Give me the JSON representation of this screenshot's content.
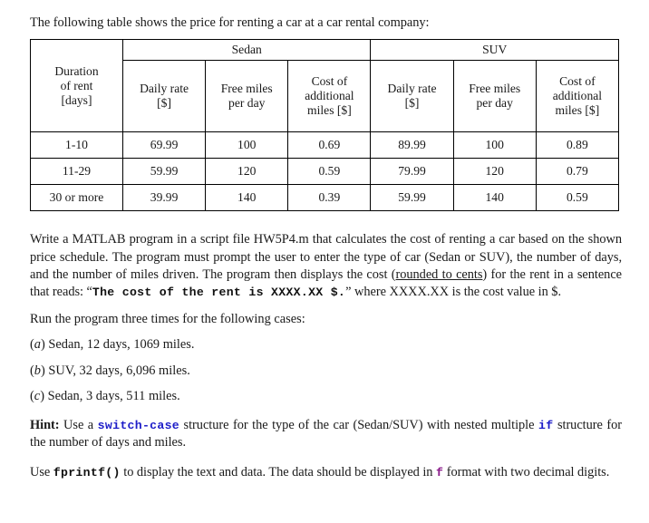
{
  "intro": {
    "text": "The following table shows the price for renting a car at a car rental company:"
  },
  "table": {
    "duration_header": {
      "line1": "Duration",
      "line2": "of rent",
      "line3": "[days]"
    },
    "groups": [
      {
        "name": "Sedan"
      },
      {
        "name": "SUV"
      }
    ],
    "sub_headers": [
      {
        "line1": "Daily rate",
        "line2": "[$]"
      },
      {
        "line1": "Free miles",
        "line2": "per day"
      },
      {
        "line1": "Cost of",
        "line2": "additional",
        "line3": "miles [$]"
      }
    ],
    "rows": [
      {
        "duration": "1-10",
        "sedan_daily": "69.99",
        "sedan_free": "100",
        "sedan_cost": "0.69",
        "suv_daily": "89.99",
        "suv_free": "100",
        "suv_cost": "0.89"
      },
      {
        "duration": "11-29",
        "sedan_daily": "59.99",
        "sedan_free": "120",
        "sedan_cost": "0.59",
        "suv_daily": "79.99",
        "suv_free": "120",
        "suv_cost": "0.79"
      },
      {
        "duration": "30 or more",
        "sedan_daily": "39.99",
        "sedan_free": "140",
        "sedan_cost": "0.39",
        "suv_daily": "59.99",
        "suv_free": "140",
        "suv_cost": "0.59"
      }
    ]
  },
  "problem": {
    "part1": "Write a MATLAB program in a script file HW5P4.m that calculates the cost of renting a car based on the shown price schedule. The program must prompt the user to enter the type of car (Sedan or SUV), the number of days, and the number of miles driven. The program then displays the cost (",
    "underlined": "rounded to cents",
    "part2": ") for the rent in a sentence that reads: “",
    "code_sentence_1": "The cost of the rent is XXXX.XX $.",
    "part3": "”  where XXXX.XX is the cost value in $."
  },
  "run_section": {
    "lead": "Run the program three times for the following cases:",
    "cases": [
      {
        "letter": "a",
        "open": "(",
        "close": ")",
        "text": " Sedan, 12 days, 1069 miles."
      },
      {
        "letter": "b",
        "open": "(",
        "close": ")",
        "text": " SUV, 32 days, 6,096 miles."
      },
      {
        "letter": "c",
        "open": "(",
        "close": ")",
        "text": " Sedan, 3 days, 511 miles."
      }
    ]
  },
  "hint": {
    "label": "Hint:",
    "part1": " Use a ",
    "code1": "switch-case",
    "part2": " structure for the type of the car (Sedan/SUV) with nested multiple ",
    "code2": "if",
    "part3": " structure for the number of days and miles."
  },
  "fprintf_note": {
    "part1": "Use ",
    "code1": "fprintf()",
    "part2": " to display the text and data. The data should be displayed in ",
    "code2": "f",
    "part3": " format with two decimal digits."
  },
  "colors": {
    "keyword_blue": "#1d1dc8",
    "format_purple": "#8a1a8a",
    "text_black": "#1a1a1a",
    "table_border": "#000000",
    "page_background": "#ffffff"
  }
}
